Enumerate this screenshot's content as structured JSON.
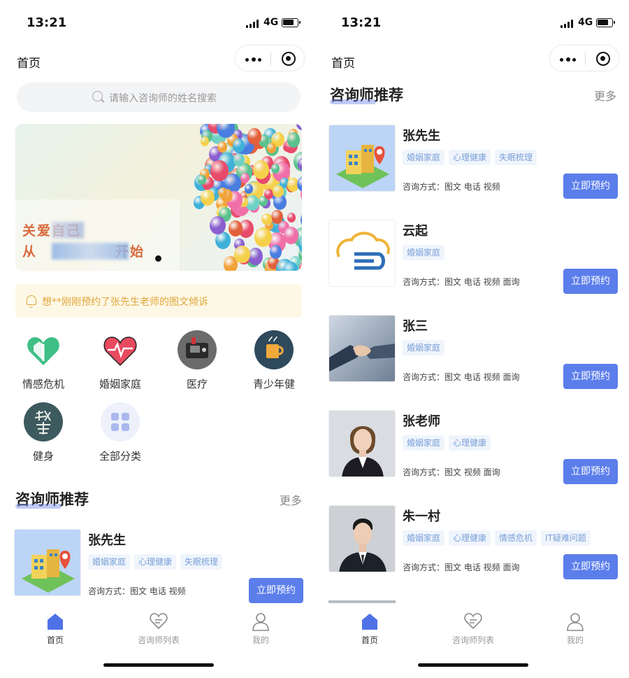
{
  "colors": {
    "accent": "#5b7eeb",
    "notice_text": "#e0a63a",
    "tag_text": "#7aa0d8",
    "banner_text": "#d96a3d"
  },
  "status": {
    "time": "13:21",
    "network": "4G"
  },
  "left": {
    "nav_title": "首页",
    "search_placeholder": "请输入咨询师的姓名搜索",
    "banner": {
      "line1": "关爱自己",
      "line2": "从",
      "line2_end": "开始"
    },
    "notice": "想**刚刚预约了张先生老师的图文倾诉",
    "categories": [
      {
        "label": "情感危机",
        "icon": "heart-home-icon"
      },
      {
        "label": "婚姻家庭",
        "icon": "heartbeat-icon"
      },
      {
        "label": "医疗",
        "icon": "medical-device-icon"
      },
      {
        "label": "青少年健",
        "icon": "cup-icon"
      },
      {
        "label": "健身",
        "icon": "calligraphy-icon"
      },
      {
        "label": "全部分类",
        "icon": "grid-icon"
      }
    ],
    "section_title": "咨询师推荐",
    "section_more": "更多",
    "counselors": [
      {
        "name": "张先生",
        "tags": [
          "婚姻家庭",
          "心理健康",
          "失眠梳理"
        ],
        "mode": "咨询方式：图文 电话 视频",
        "button": "立即预约",
        "avatar": "building-icon"
      }
    ]
  },
  "right": {
    "nav_title": "首页",
    "section_title": "咨询师推荐",
    "section_more": "更多",
    "counselors": [
      {
        "name": "张先生",
        "tags": [
          "婚姻家庭",
          "心理健康",
          "失眠梳理"
        ],
        "mode": "咨询方式：图文 电话 视频",
        "button": "立即预约",
        "avatar": "building-icon"
      },
      {
        "name": "云起",
        "tags": [
          "婚姻家庭"
        ],
        "mode": "咨询方式：图文 电话 视频 面询",
        "button": "立即预约",
        "avatar": "cloud-logo-icon"
      },
      {
        "name": "张三",
        "tags": [
          "婚姻家庭"
        ],
        "mode": "咨询方式：图文 电话 视频 面询",
        "button": "立即预约",
        "avatar": "handshake-photo"
      },
      {
        "name": "张老师",
        "tags": [
          "婚姻家庭",
          "心理健康"
        ],
        "mode": "咨询方式：图文 视频 面询",
        "button": "立即预约",
        "avatar": "portrait-woman-photo"
      },
      {
        "name": "朱一村",
        "tags": [
          "婚姻家庭",
          "心理健康",
          "情感危机",
          "IT疑难问题"
        ],
        "mode": "咨询方式：图文 电话 视频 面询",
        "button": "立即预约",
        "avatar": "portrait-man-photo"
      }
    ]
  },
  "tabbar": [
    {
      "label": "首页",
      "icon": "home-icon",
      "active": true
    },
    {
      "label": "咨询师列表",
      "icon": "chat-heart-icon",
      "active": false
    },
    {
      "label": "我的",
      "icon": "user-icon",
      "active": false
    }
  ]
}
